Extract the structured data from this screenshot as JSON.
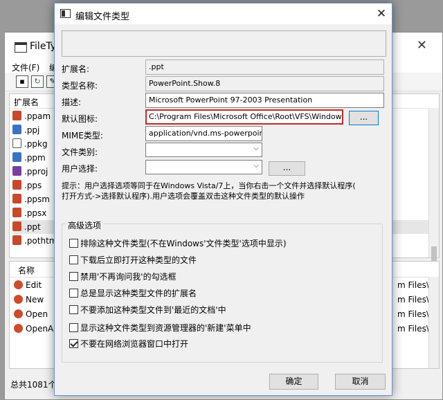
{
  "background_window": {
    "title": "FileTyp",
    "menu": [
      "文件(F)",
      "编"
    ],
    "extension_header": "扩展名",
    "extensions": [
      ".ppam",
      ".ppj",
      ".ppkg",
      ".ppm",
      ".pproj",
      ".pps",
      ".ppsm",
      ".ppsx",
      ".ppt",
      ".pothtm"
    ],
    "selected_extension": ".ppt",
    "lower_header": "名称",
    "verbs": [
      "Edit",
      "New",
      "Open",
      "OpenAs"
    ],
    "path_fragments": [
      "m Files\\M",
      "m Files\\M",
      "m Files\\M",
      "m Files\\M"
    ],
    "status": "总共1081个"
  },
  "dialog": {
    "title": "编辑文件类型",
    "close_glyph": "✕",
    "fields": {
      "extension_label": "扩展名:",
      "extension_value": ".ppt",
      "type_name_label": "类型名称:",
      "type_name_value": "PowerPoint.Show.8",
      "description_label": "描述:",
      "description_value": "Microsoft PowerPoint 97-2003 Presentation",
      "default_icon_label": "默认图标:",
      "default_icon_value": "C:\\Program Files\\Microsoft Office\\Root\\VFS\\Windows\\Insta",
      "mime_label": "MIME类型:",
      "mime_value": "application/vnd.ms-powerpoint",
      "category_label": "文件类别:",
      "category_value": "",
      "user_choice_label": "用户选择:",
      "user_choice_value": "",
      "browse_label": "...",
      "browse_user_label": "..."
    },
    "hint_line1": "提示：用户选择选项等同于在Windows Vista/7上，当你右击一个文件并选择默认程序(",
    "hint_line2": "打开方式->选择默认程序).用户选项会覆盖双击这种文件类型的默认操作",
    "advanced_title": "高级选项",
    "options": [
      {
        "label": "排除这种文件类型(不在Windows'文件类型'选项中显示)",
        "checked": false
      },
      {
        "label": "下载后立即打开这种类型的文件",
        "checked": false
      },
      {
        "label": "禁用'不再询问我'的勾选框",
        "checked": false
      },
      {
        "label": "总是显示这种类型文件的扩展名",
        "checked": false
      },
      {
        "label": "不要添加这种类型文件到'最近的文档'中",
        "checked": false
      },
      {
        "label": "显示这种文件类型到资源管理器的'新建'菜单中",
        "checked": false
      },
      {
        "label": "不要在网络浏览器窗口中打开",
        "checked": true
      }
    ],
    "ok_label": "确定",
    "cancel_label": "取消"
  },
  "colors": {
    "highlight_border": "#c62828",
    "dialog_border": "#6b8fc9",
    "focus_blue": "#0078d7"
  }
}
